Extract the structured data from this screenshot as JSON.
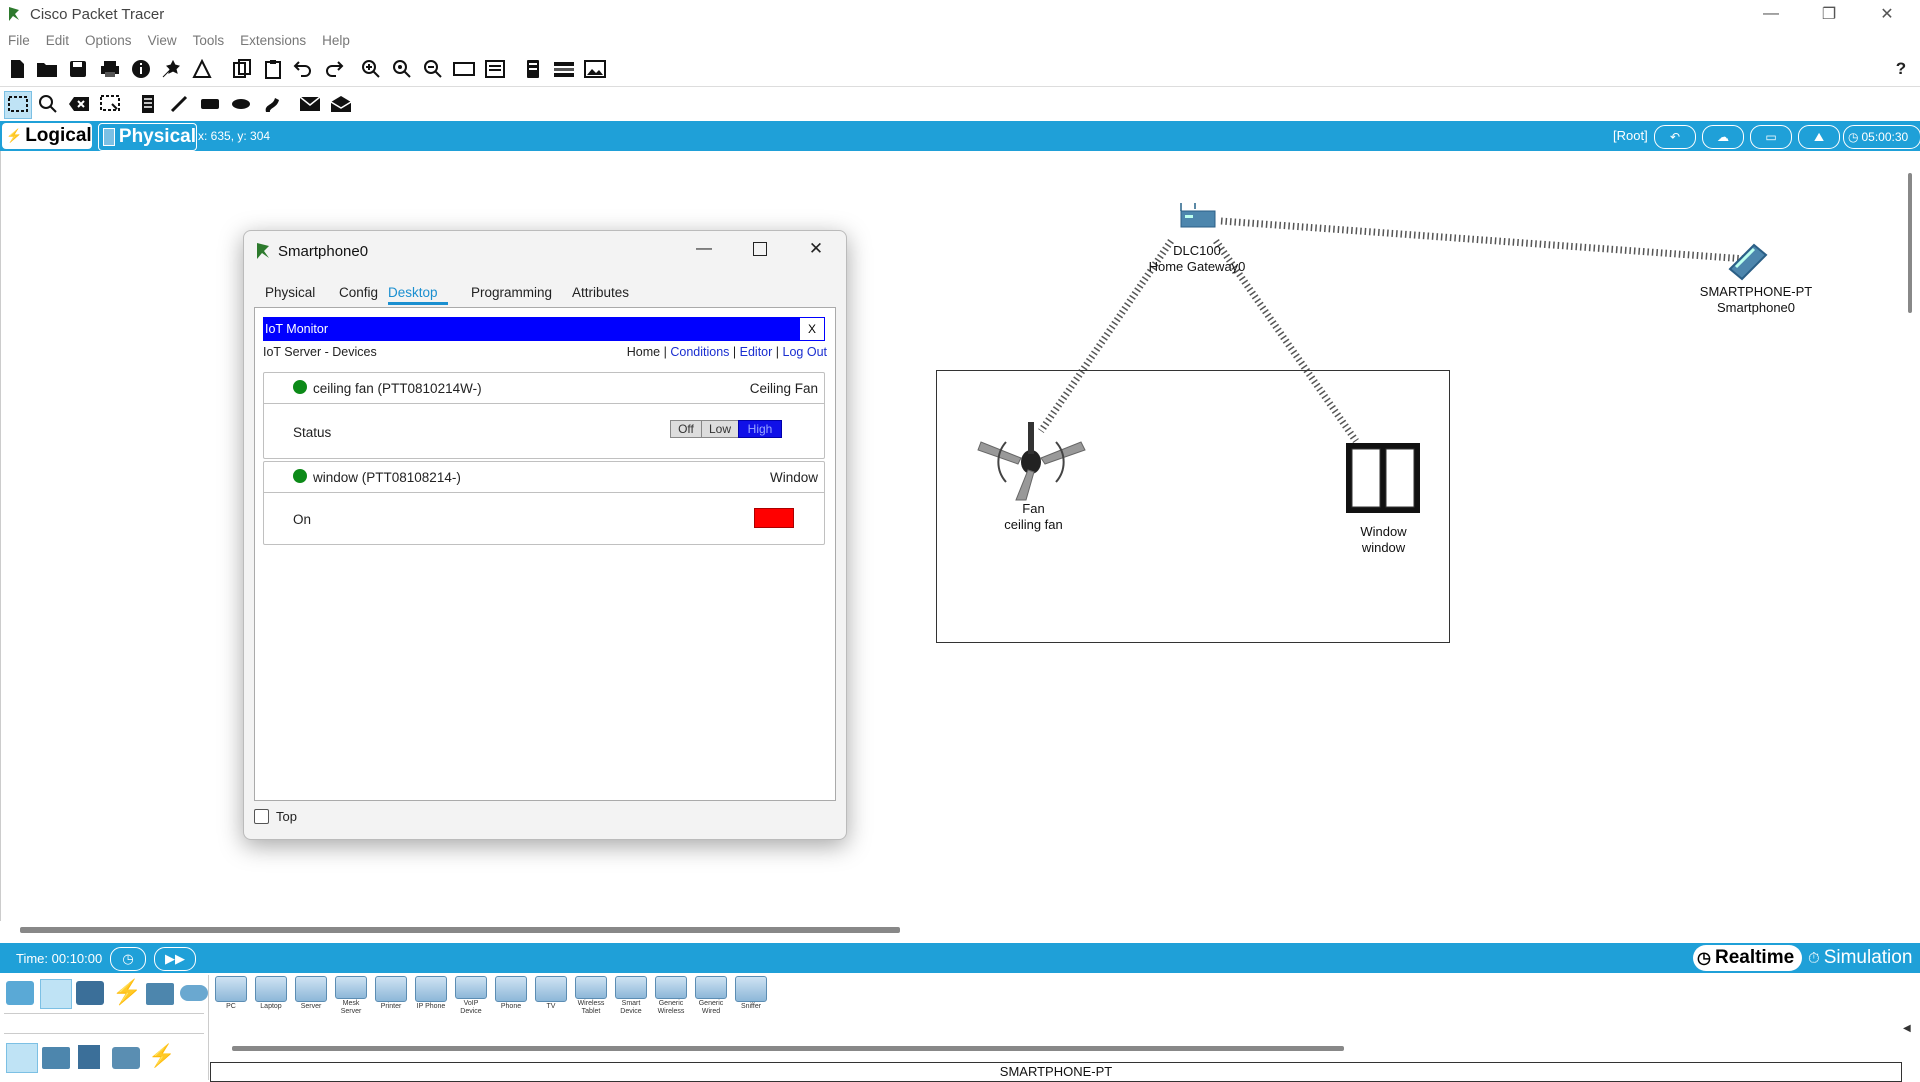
{
  "app": {
    "title": "Cisco Packet Tracer",
    "window_controls": {
      "minimize": "—",
      "restore": "❐",
      "close": "✕"
    }
  },
  "menu": [
    "File",
    "Edit",
    "Options",
    "View",
    "Tools",
    "Extensions",
    "Help"
  ],
  "toolbar": {
    "help_label": "?",
    "icons": [
      "new-file-icon",
      "open-folder-icon",
      "save-icon",
      "print-icon",
      "info-icon",
      "network-wizard-icon",
      "activity-wizard-icon",
      "copy-icon",
      "paste-icon",
      "undo-icon",
      "redo-icon",
      "zoom-in-icon",
      "zoom-reset-icon",
      "zoom-out-icon",
      "draw-palette-icon",
      "custom-device-icon",
      "viewport-icon",
      "pdu-list-icon",
      "image-icon"
    ],
    "secondary_icons": [
      "select-icon",
      "inspect-icon",
      "delete-icon",
      "resize-shape-icon",
      "note-icon",
      "draw-line-icon",
      "draw-rectangle-icon",
      "draw-ellipse-icon",
      "freeform-icon",
      "add-simple-pdu-icon",
      "add-complex-pdu-icon"
    ]
  },
  "viewbar": {
    "logical_label": "Logical",
    "physical_label": "Physical",
    "coords": "x: 635, y: 304",
    "root_label": "[Root]",
    "clock": "05:00:30"
  },
  "dialog": {
    "title": "Smartphone0",
    "tabs": [
      "Physical",
      "Config",
      "Desktop",
      "Programming",
      "Attributes"
    ],
    "active_tab": "Desktop",
    "iot": {
      "header": "IoT Monitor",
      "close_label": "X",
      "subtitle": "IoT Server - Devices",
      "nav": {
        "home": "Home",
        "sep1": "|",
        "conditions": "Conditions",
        "sep2": "|",
        "editor": "Editor",
        "sep3": "|",
        "logout": "Log Out"
      },
      "devices": [
        {
          "name": "ceiling fan (PTT0810214W-)",
          "type": "Ceiling Fan",
          "prop_label": "Status",
          "options": [
            "Off",
            "Low",
            "High"
          ],
          "selected": "High",
          "status_color": "#0c8a18"
        },
        {
          "name": "window (PTT08108214-)",
          "type": "Window",
          "prop_label": "On",
          "indicator_color": "#ff0000",
          "status_color": "#0c8a18"
        }
      ]
    },
    "top_checkbox_label": "Top"
  },
  "canvas": {
    "gateway": {
      "model": "DLC100",
      "name": "Home Gateway0"
    },
    "smartphone": {
      "model": "SMARTPHONE-PT",
      "name": "Smartphone0"
    },
    "fan": {
      "model": "Fan",
      "name": "ceiling fan"
    },
    "window": {
      "model": "Window",
      "name": "window"
    }
  },
  "bottom": {
    "time": "Time: 00:10:00",
    "realtime_label": "Realtime",
    "simulation_label": "Simulation",
    "device_categories": [
      "network-devices-icon",
      "end-devices-icon",
      "components-icon",
      "connections-icon",
      "misc-icon",
      "multiuser-icon"
    ],
    "sub_categories": [
      "end-devices-sub-icon",
      "home-icon",
      "smart-city-icon",
      "industrial-icon",
      "power-grid-icon"
    ],
    "devices": [
      {
        "label": "PC"
      },
      {
        "label": "Laptop"
      },
      {
        "label": "Server"
      },
      {
        "label": "Mesk Server"
      },
      {
        "label": "Printer"
      },
      {
        "label": "IP Phone"
      },
      {
        "label": "VoIP Device"
      },
      {
        "label": "Phone"
      },
      {
        "label": "TV"
      },
      {
        "label": "Wireless Tablet"
      },
      {
        "label": "Smart Device"
      },
      {
        "label": "Generic Wireless"
      },
      {
        "label": "Generic Wired"
      },
      {
        "label": "Sniffer"
      }
    ],
    "selected_device": "SMARTPHONE-PT"
  },
  "colors": {
    "accent_blue": "#1fa0d8",
    "iot_header": "#0000ff",
    "status_green": "#0c8a18"
  }
}
